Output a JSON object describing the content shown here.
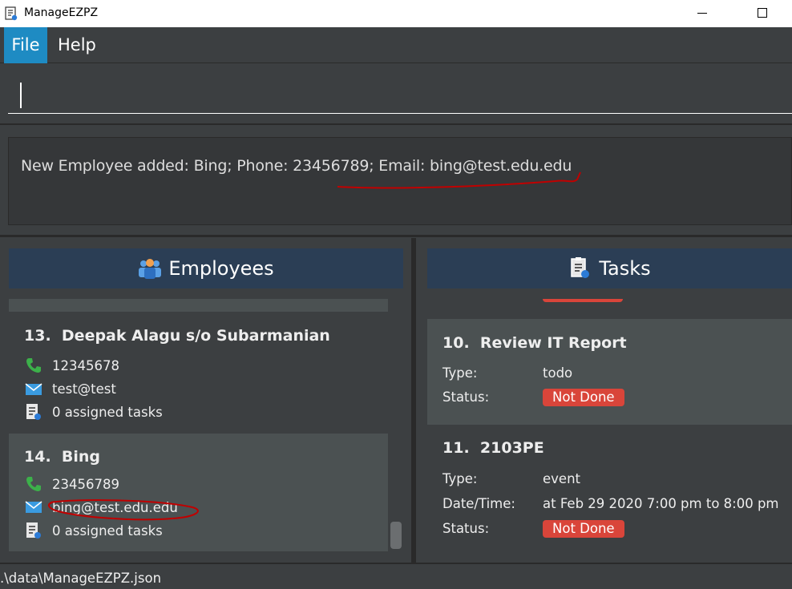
{
  "window": {
    "title": "ManageEZPZ",
    "icon": "app-checklist-icon"
  },
  "menu": {
    "file": "File",
    "help": "Help"
  },
  "command": {
    "value": ""
  },
  "result": {
    "text": "New Employee added: Bing; Phone: 23456789; Email: bing@test.edu.edu"
  },
  "employees": {
    "header": "Employees",
    "header_icon": "employees-icon",
    "items": [
      {
        "index": "13.",
        "name": "Deepak Alagu s/o Subarmanian",
        "phone": "12345678",
        "email": "test@test",
        "tasks": "0 assigned tasks"
      },
      {
        "index": "14.",
        "name": "Bing",
        "phone": "23456789",
        "email": "bing@test.edu.edu",
        "tasks": "0 assigned tasks"
      }
    ]
  },
  "tasks": {
    "header": "Tasks",
    "header_icon": "tasks-icon",
    "items": [
      {
        "index": "10.",
        "name": "Review IT Report",
        "type_label": "Type:",
        "type": "todo",
        "status_label": "Status:",
        "status": "Not Done"
      },
      {
        "index": "11.",
        "name": "2103PE",
        "type_label": "Type:",
        "type": "event",
        "datetime_label": "Date/Time:",
        "datetime": "at Feb 29 2020 7:00 pm to 8:00 pm",
        "status_label": "Status:",
        "status": "Not Done"
      }
    ]
  },
  "statusbar": {
    "path": ".\\data\\ManageEZPZ.json"
  },
  "colors": {
    "accent": "#1e8bc3",
    "panel_header": "#2b3e55",
    "status_not_done": "#d9453a",
    "annotation": "#c00000"
  }
}
